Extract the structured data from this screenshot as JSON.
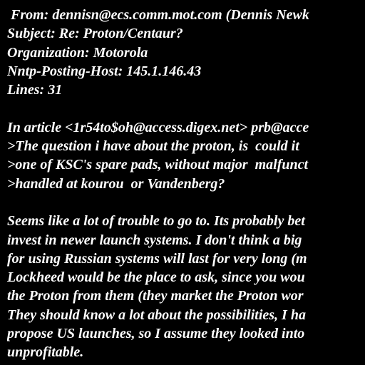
{
  "header": {
    "from": " From: dennisn@ecs.comm.mot.com (Dennis Newk",
    "subject": "Subject: Re: Proton/Centaur?",
    "organization": "Organization: Motorola",
    "nntp_host": "Nntp-Posting-Host: 145.1.146.43",
    "lines": "Lines: 31"
  },
  "quote": {
    "attribution": "In article <1r54to$oh@access.digex.net> prb@acce",
    "lines": [
      ">The question i have about the proton, is  could it",
      ">one of KSC's spare pads, without major  malfunct",
      ">handled at kourou  or Vandenberg?"
    ]
  },
  "body": {
    "lines": [
      "Seems like a lot of trouble to go to. Its probably bet",
      "invest in newer launch systems. I don't think a big",
      "for using Russian systems will last for very long (m",
      "Lockheed would be the place to ask, since you wou",
      "the Proton from them (they market the Proton wor",
      "They should know a lot about the possibilities, I ha",
      "propose US launches, so I assume they looked into",
      "unprofitable."
    ]
  },
  "colors": {
    "background": "#000000",
    "text": "#ffffff"
  }
}
